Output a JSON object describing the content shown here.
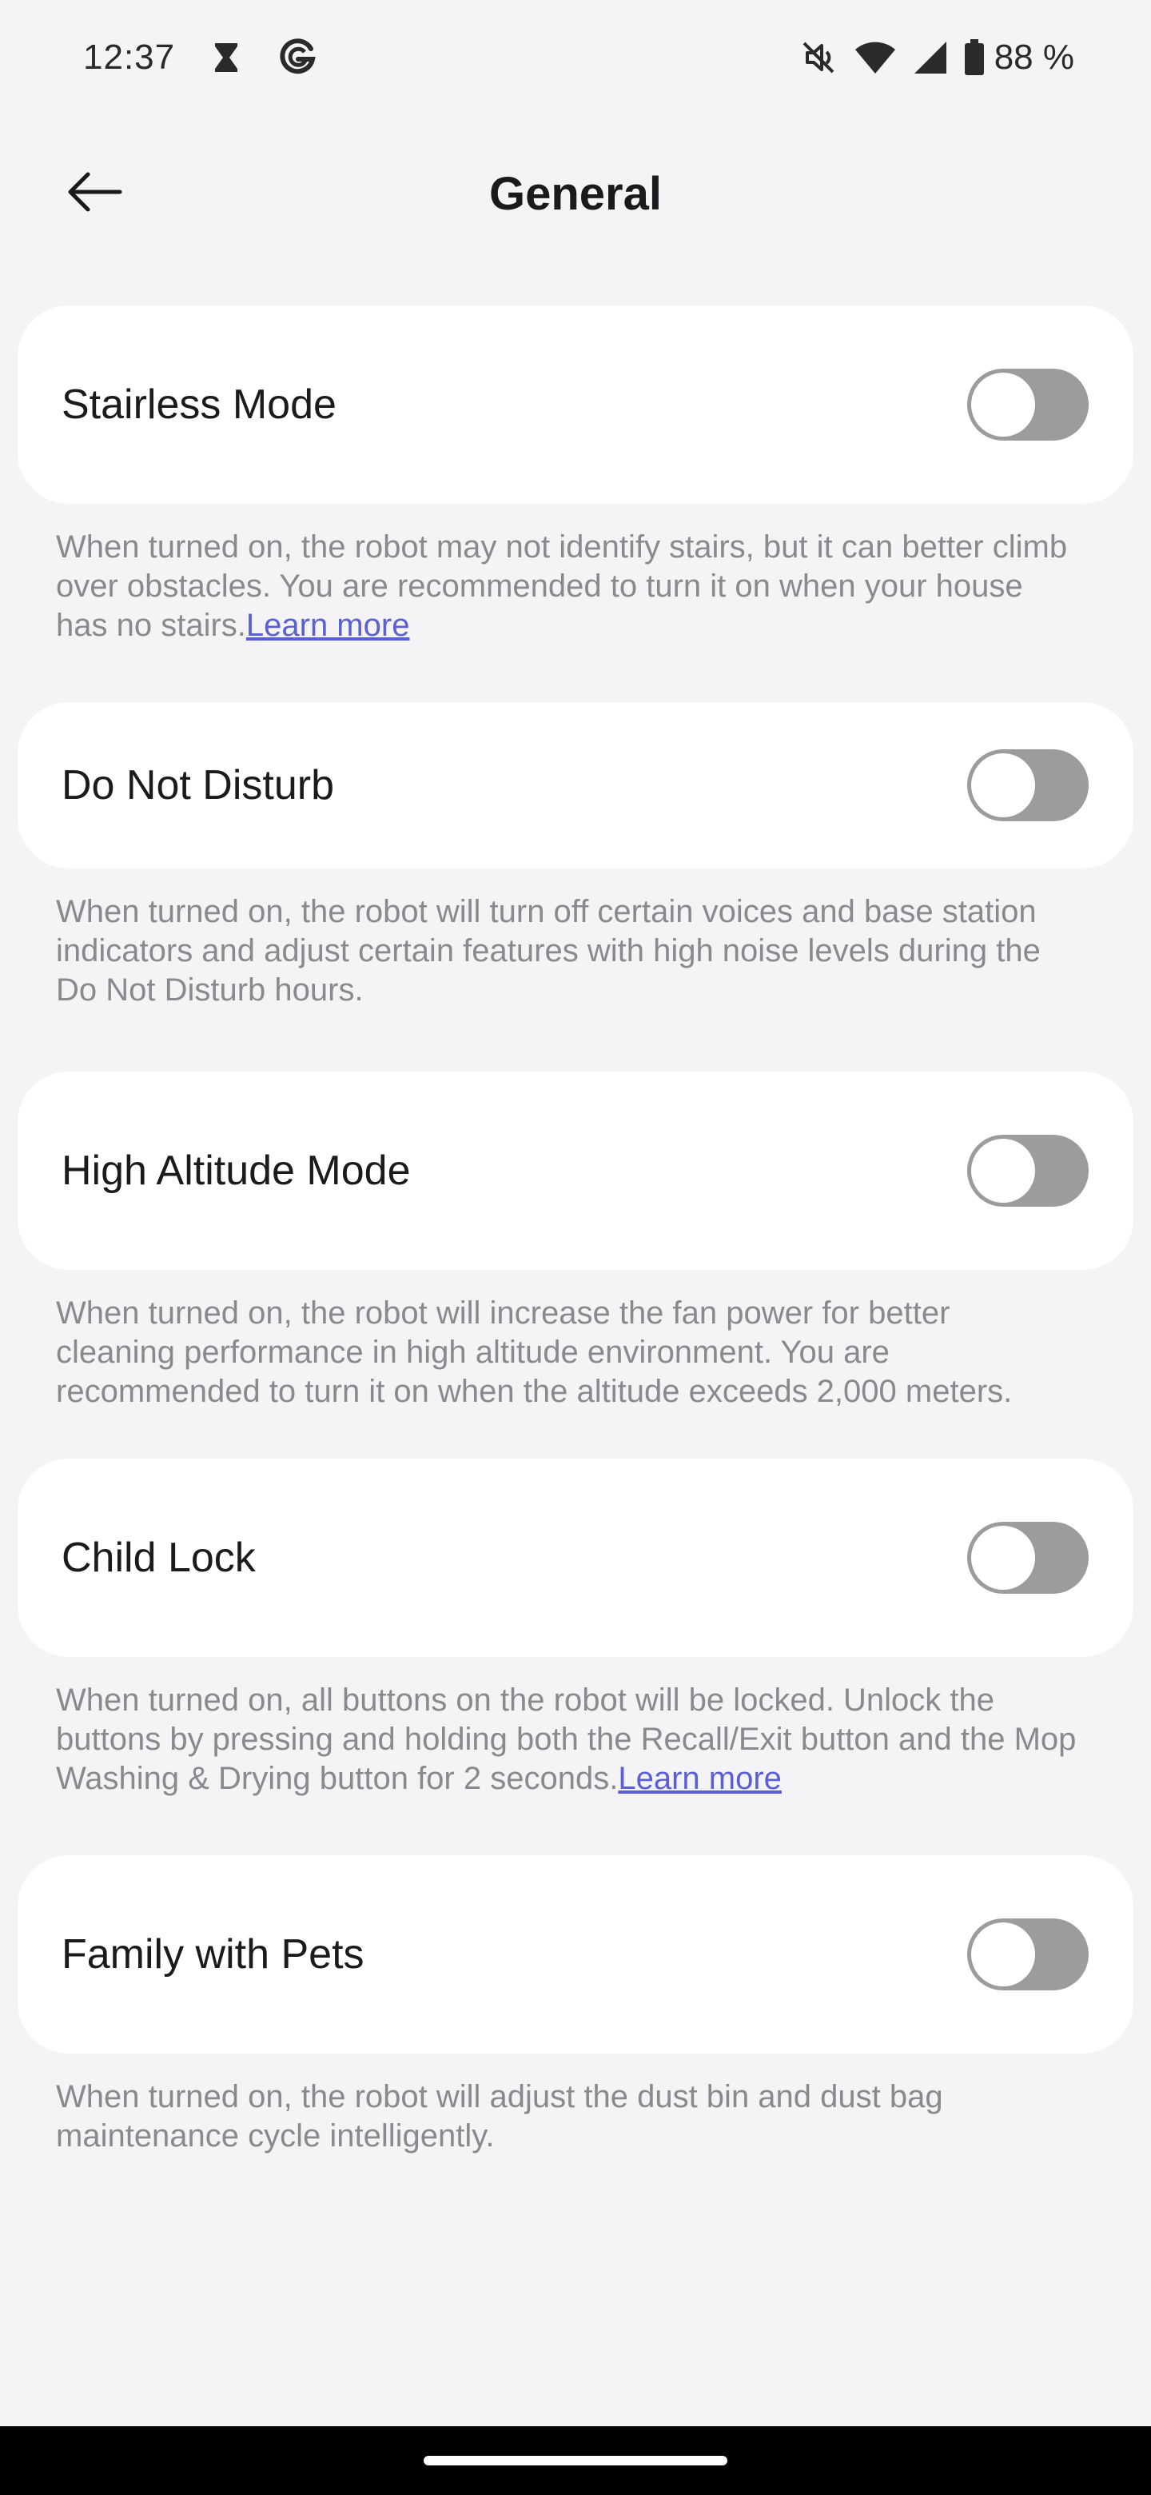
{
  "status_bar": {
    "time": "12:37",
    "left_icons": [
      "hourglass-icon",
      "g-app-icon"
    ],
    "right_icons": [
      "vibrate-mute-icon",
      "wifi-icon",
      "cell-signal-icon",
      "battery-icon"
    ],
    "battery_percent": "88 %"
  },
  "header": {
    "back_icon": "arrow-left-icon",
    "title": "General"
  },
  "settings": [
    {
      "label": "Stairless Mode",
      "enabled": false,
      "description": "When turned on, the robot may not identify stairs, but it can better climb over obstacles. You are recommended to turn it on when your house has no stairs.",
      "link": "Learn more"
    },
    {
      "label": "Do Not Disturb",
      "enabled": false,
      "description": "When turned on, the robot will turn off certain voices and base station indicators and adjust certain features with high noise levels during the Do Not Disturb hours."
    },
    {
      "label": "High Altitude Mode",
      "enabled": false,
      "description": "When turned on, the robot will increase the fan power for better cleaning performance in high altitude environment. You are recommended to turn it on when the altitude exceeds 2,000 meters."
    },
    {
      "label": "Child Lock",
      "enabled": false,
      "description": "When turned on, all buttons on the robot will be locked. Unlock the buttons by pressing and holding both the Recall/Exit button and the Mop Washing & Drying button for 2 seconds.",
      "link": "Learn more"
    },
    {
      "label": "Family with Pets",
      "enabled": false,
      "description": "When turned on, the robot will adjust the dust bin and dust bag maintenance cycle intelligently."
    }
  ],
  "colors": {
    "background": "#f4f4f6",
    "card": "#ffffff",
    "toggle_off": "#9c9c9f",
    "link": "#5b5fd6",
    "description_text": "#8a8a8e"
  }
}
